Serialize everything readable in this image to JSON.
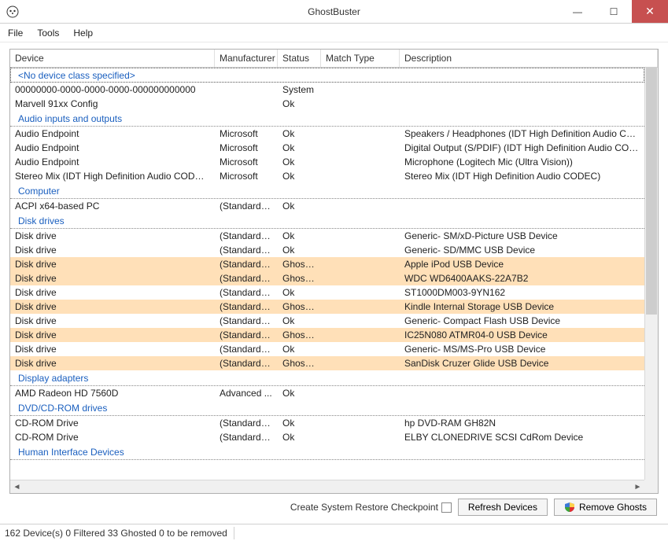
{
  "window": {
    "title": "GhostBuster"
  },
  "menu": {
    "file": "File",
    "tools": "Tools",
    "help": "Help"
  },
  "columns": {
    "device": "Device",
    "mfr": "Manufacturer",
    "status": "Status",
    "match": "Match Type",
    "desc": "Description"
  },
  "groups": [
    {
      "name": "<No device class specified>",
      "selected": true,
      "rows": [
        {
          "device": "00000000-0000-0000-0000-000000000000",
          "mfr": "",
          "status": "System",
          "match": "",
          "desc": "",
          "ghosted": false
        },
        {
          "device": "Marvell 91xx Config",
          "mfr": "",
          "status": "Ok",
          "match": "",
          "desc": "",
          "ghosted": false
        }
      ]
    },
    {
      "name": "Audio inputs and outputs",
      "rows": [
        {
          "device": "Audio Endpoint",
          "mfr": "Microsoft",
          "status": "Ok",
          "match": "",
          "desc": "Speakers / Headphones (IDT High Definition Audio CODEC)",
          "ghosted": false
        },
        {
          "device": "Audio Endpoint",
          "mfr": "Microsoft",
          "status": "Ok",
          "match": "",
          "desc": "Digital Output (S/PDIF) (IDT High Definition Audio CODEC)",
          "ghosted": false
        },
        {
          "device": "Audio Endpoint",
          "mfr": "Microsoft",
          "status": "Ok",
          "match": "",
          "desc": "Microphone (Logitech Mic (Ultra Vision))",
          "ghosted": false
        },
        {
          "device": "Stereo Mix (IDT High Definition Audio CODEC)",
          "mfr": "Microsoft",
          "status": "Ok",
          "match": "",
          "desc": "Stereo Mix (IDT High Definition Audio CODEC)",
          "ghosted": false
        }
      ]
    },
    {
      "name": "Computer",
      "rows": [
        {
          "device": "ACPI x64-based PC",
          "mfr": "(Standard c...",
          "status": "Ok",
          "match": "",
          "desc": "",
          "ghosted": false
        }
      ]
    },
    {
      "name": "Disk drives",
      "rows": [
        {
          "device": "Disk drive",
          "mfr": "(Standard di...",
          "status": "Ok",
          "match": "",
          "desc": "Generic- SM/xD-Picture USB Device",
          "ghosted": false
        },
        {
          "device": "Disk drive",
          "mfr": "(Standard di...",
          "status": "Ok",
          "match": "",
          "desc": "Generic- SD/MMC USB Device",
          "ghosted": false
        },
        {
          "device": "Disk drive",
          "mfr": "(Standard di...",
          "status": "Ghosted",
          "match": "",
          "desc": "Apple iPod USB Device",
          "ghosted": true
        },
        {
          "device": "Disk drive",
          "mfr": "(Standard di...",
          "status": "Ghosted",
          "match": "",
          "desc": "WDC WD6400AAKS-22A7B2",
          "ghosted": true
        },
        {
          "device": "Disk drive",
          "mfr": "(Standard di...",
          "status": "Ok",
          "match": "",
          "desc": "ST1000DM003-9YN162",
          "ghosted": false
        },
        {
          "device": "Disk drive",
          "mfr": "(Standard di...",
          "status": "Ghosted",
          "match": "",
          "desc": "Kindle Internal Storage USB Device",
          "ghosted": true
        },
        {
          "device": "Disk drive",
          "mfr": "(Standard di...",
          "status": "Ok",
          "match": "",
          "desc": "Generic- Compact Flash USB Device",
          "ghosted": false
        },
        {
          "device": "Disk drive",
          "mfr": "(Standard di...",
          "status": "Ghosted",
          "match": "",
          "desc": "IC25N080 ATMR04-0 USB Device",
          "ghosted": true
        },
        {
          "device": "Disk drive",
          "mfr": "(Standard di...",
          "status": "Ok",
          "match": "",
          "desc": "Generic- MS/MS-Pro USB Device",
          "ghosted": false
        },
        {
          "device": "Disk drive",
          "mfr": "(Standard di...",
          "status": "Ghosted",
          "match": "",
          "desc": "SanDisk Cruzer Glide USB Device",
          "ghosted": true
        }
      ]
    },
    {
      "name": "Display adapters",
      "rows": [
        {
          "device": "AMD Radeon HD 7560D",
          "mfr": "Advanced ...",
          "status": "Ok",
          "match": "",
          "desc": "",
          "ghosted": false
        }
      ]
    },
    {
      "name": "DVD/CD-ROM drives",
      "rows": [
        {
          "device": "CD-ROM Drive",
          "mfr": "(Standard C...",
          "status": "Ok",
          "match": "",
          "desc": "hp DVD-RAM GH82N",
          "ghosted": false
        },
        {
          "device": "CD-ROM Drive",
          "mfr": "(Standard C...",
          "status": "Ok",
          "match": "",
          "desc": "ELBY CLONEDRIVE SCSI CdRom Device",
          "ghosted": false
        }
      ]
    },
    {
      "name": "Human Interface Devices",
      "rows": []
    }
  ],
  "footer": {
    "checkpoint_label": "Create System Restore Checkpoint",
    "refresh_label": "Refresh Devices",
    "remove_label": "Remove Ghosts"
  },
  "status": {
    "text": "162 Device(s)  0 Filtered  33 Ghosted  0 to be removed"
  }
}
